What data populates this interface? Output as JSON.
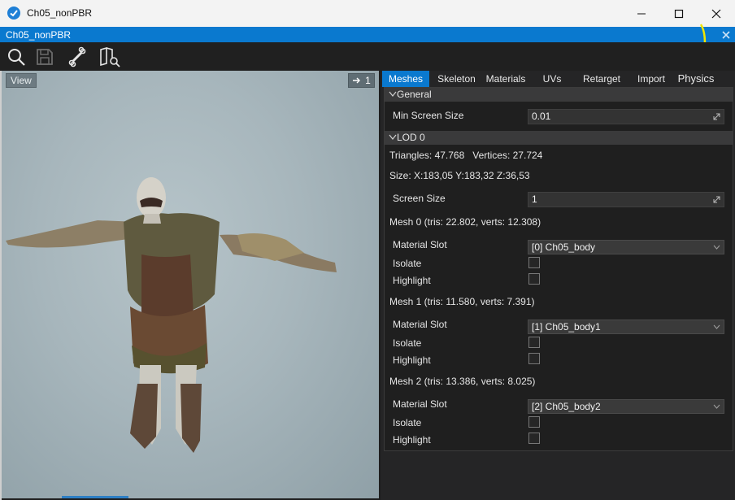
{
  "window": {
    "title": "Ch05_nonPBR",
    "doc_tab_label": "Ch05_nonPBR"
  },
  "viewport": {
    "view_label": "View",
    "camera_speed": "1"
  },
  "tabs": [
    {
      "label": "Meshes",
      "active": true
    },
    {
      "label": "Skeleton"
    },
    {
      "label": "Materials"
    },
    {
      "label": "UVs"
    },
    {
      "label": "Retarget"
    },
    {
      "label": "Import"
    },
    {
      "label": "Physics"
    }
  ],
  "general": {
    "header": "General",
    "min_screen_size_label": "Min Screen Size",
    "min_screen_size_value": "0.01"
  },
  "lod0": {
    "header": "LOD 0",
    "stats": "Triangles: 47.768   Vertices: 27.724",
    "size": "Size: X:183,05 Y:183,32 Z:36,53",
    "screen_size_label": "Screen Size",
    "screen_size_value": "1",
    "meshes": [
      {
        "title": "Mesh 0 (tris: 22.802, verts: 12.308)",
        "material_slot_label": "Material Slot",
        "material": "[0] Ch05_body",
        "isolate_label": "Isolate",
        "highlight_label": "Highlight"
      },
      {
        "title": "Mesh 1 (tris: 11.580, verts: 7.391)",
        "material_slot_label": "Material Slot",
        "material": "[1] Ch05_body1",
        "isolate_label": "Isolate",
        "highlight_label": "Highlight"
      },
      {
        "title": "Mesh 2 (tris: 13.386, verts: 8.025)",
        "material_slot_label": "Material Slot",
        "material": "[2] Ch05_body2",
        "isolate_label": "Isolate",
        "highlight_label": "Highlight"
      }
    ]
  },
  "colors": {
    "accent": "#0a79cf",
    "annotation": "#f2e600"
  },
  "icons": [
    "search-icon",
    "save-icon",
    "bone-icon",
    "book-search-icon",
    "arrow-right-icon",
    "expand-icon",
    "chevron-down-icon"
  ]
}
